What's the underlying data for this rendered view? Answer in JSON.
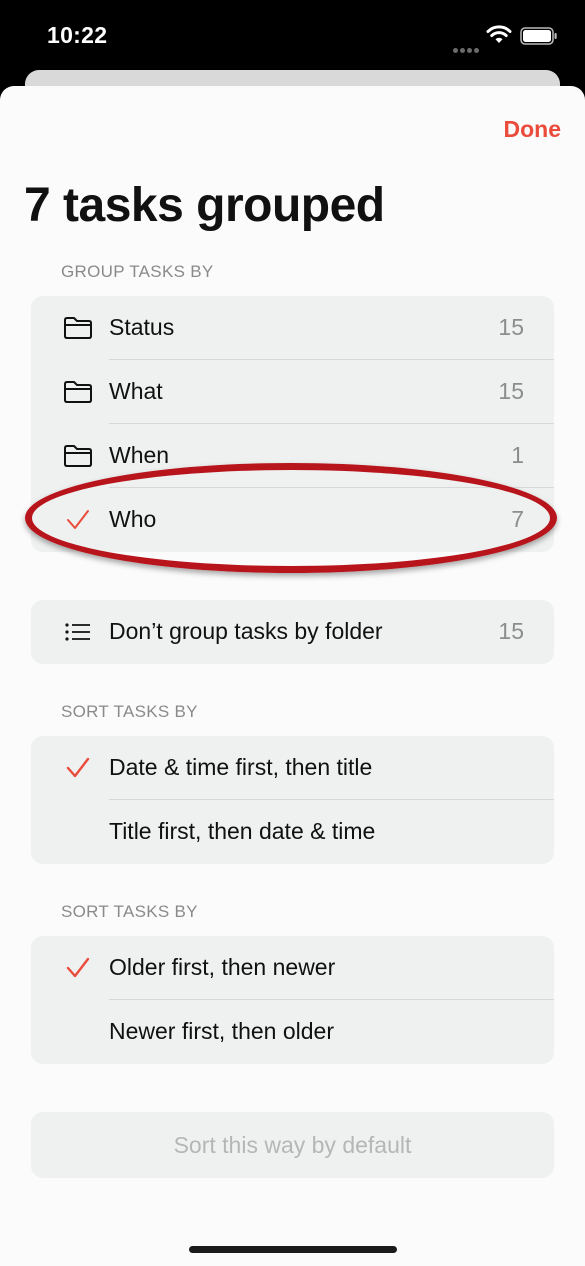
{
  "status_bar": {
    "time": "10:22"
  },
  "header": {
    "done_label": "Done",
    "title": "7 tasks grouped"
  },
  "group_section": {
    "label": "GROUP TASKS BY",
    "items": [
      {
        "label": "Status",
        "count": "15",
        "icon": "folder-icon",
        "selected": false
      },
      {
        "label": "What",
        "count": "15",
        "icon": "folder-icon",
        "selected": false
      },
      {
        "label": "When",
        "count": "1",
        "icon": "folder-icon",
        "selected": false
      },
      {
        "label": "Who",
        "count": "7",
        "icon": "checkmark-icon",
        "selected": true
      }
    ]
  },
  "no_group": {
    "label": "Don’t group tasks by folder",
    "count": "15",
    "icon": "list-icon"
  },
  "sort_section_1": {
    "label": "SORT TASKS BY",
    "items": [
      {
        "label": "Date & time first, then title",
        "selected": true
      },
      {
        "label": "Title first, then date & time",
        "selected": false
      }
    ]
  },
  "sort_section_2": {
    "label": "SORT TASKS BY",
    "items": [
      {
        "label": "Older first, then newer",
        "selected": true
      },
      {
        "label": "Newer first, then older",
        "selected": false
      }
    ]
  },
  "default_button": {
    "label": "Sort this way by default"
  },
  "colors": {
    "accent": "#ea4b3b",
    "annotation": "#b8141b"
  }
}
